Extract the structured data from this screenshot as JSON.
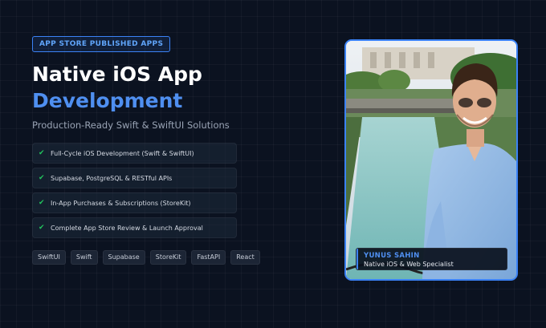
{
  "hero": {
    "badge": "APP STORE PUBLISHED APPS",
    "title_line1": "Native iOS App",
    "title_line2": "Development",
    "subtitle": "Production-Ready Swift & SwiftUI Solutions",
    "features": [
      {
        "icon": "check-icon",
        "text": "Full-Cycle iOS Development (Swift & SwiftUI)"
      },
      {
        "icon": "check-icon",
        "text": "Supabase, PostgreSQL & RESTful APIs"
      },
      {
        "icon": "check-icon",
        "text": "In-App Purchases & Subscriptions (StoreKit)"
      },
      {
        "icon": "check-icon",
        "text": "Complete App Store Review & Launch Approval"
      }
    ],
    "tags": [
      "SwiftUI",
      "Swift",
      "Supabase",
      "StoreKit",
      "FastAPI",
      "React"
    ]
  },
  "profile": {
    "name": "YUNUS SAHIN",
    "role": "Native iOS & Web Specialist"
  },
  "colors": {
    "background": "#0b1220",
    "accent": "#3b82f6",
    "accent_text": "#4f8ff0",
    "check": "#22c55e"
  }
}
